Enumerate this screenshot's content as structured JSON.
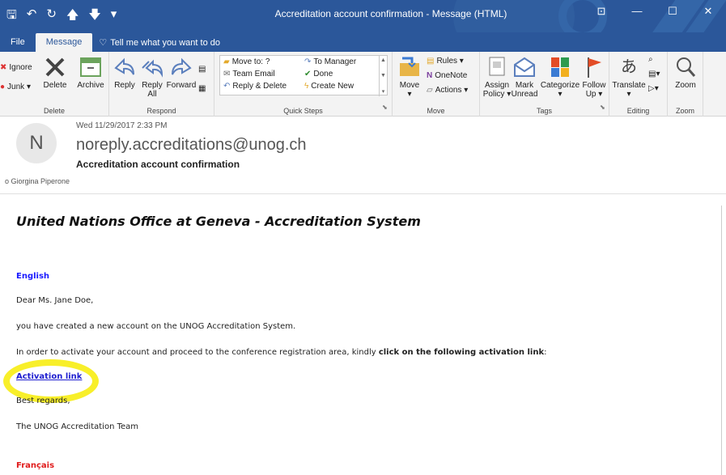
{
  "window": {
    "title": "Accreditation account confirmation  -  Message (HTML)",
    "quick_access": [
      "🖫",
      "↶",
      "↻",
      "🡅",
      "🡇",
      "▾"
    ],
    "controls": [
      "⊡",
      "—",
      "☐",
      "✕"
    ]
  },
  "tabs": [
    "File",
    "Message"
  ],
  "tell_me": "Tell me what you want to do",
  "ribbon": {
    "delete": {
      "label": "Delete",
      "ignore": "Ignore",
      "junk": "Junk ▾",
      "delete_btn": "Delete",
      "archive": "Archive"
    },
    "respond": {
      "label": "Respond",
      "reply": "Reply",
      "reply_all": "Reply\nAll",
      "forward": "Forward"
    },
    "quick_steps": {
      "label": "Quick Steps",
      "items": [
        "Move to: ?",
        "Team Email",
        "Reply & Delete",
        "To Manager",
        "Done",
        "Create New"
      ]
    },
    "move": {
      "label": "Move",
      "move_btn": "Move",
      "rules": "Rules ▾",
      "onenote": "OneNote",
      "actions": "Actions ▾"
    },
    "tags": {
      "label": "Tags",
      "assign_policy": "Assign\nPolicy ▾",
      "mark_unread": "Mark\nUnread",
      "categorize": "Categorize\n▾",
      "follow_up": "Follow\nUp ▾"
    },
    "editing": {
      "label": "Editing",
      "translate": "Translate\n▾"
    },
    "zoom": {
      "label": "Zoom",
      "zoom_btn": "Zoom"
    }
  },
  "message": {
    "date": "Wed 11/29/2017 2:33 PM",
    "avatar_letter": "N",
    "from": "noreply.accreditations@unog.ch",
    "subject": "Accreditation account confirmation",
    "to": "Giorgina Piperone",
    "body": {
      "title": "United Nations Office at Geneva - Accreditation System",
      "lang_en": "English",
      "greeting": "Dear Ms. Jane Doe,",
      "line1": "you have created a new account on the UNOG Accreditation System.",
      "line2_prefix": "In order to activate your account and proceed to the conference registration area, kindly ",
      "line2_bold": "click on the following activation link",
      "line2_suffix": ":",
      "activation_link": "Activation link",
      "regards": "Best regards,",
      "signature": "The UNOG Accreditation Team",
      "lang_fr": "Français"
    }
  },
  "colors": {
    "titlebar": "#2b579a",
    "highlight": "#f8ef2a",
    "link": "#1f1fd0",
    "french": "#e01b1b",
    "english": "#1a1aff"
  }
}
